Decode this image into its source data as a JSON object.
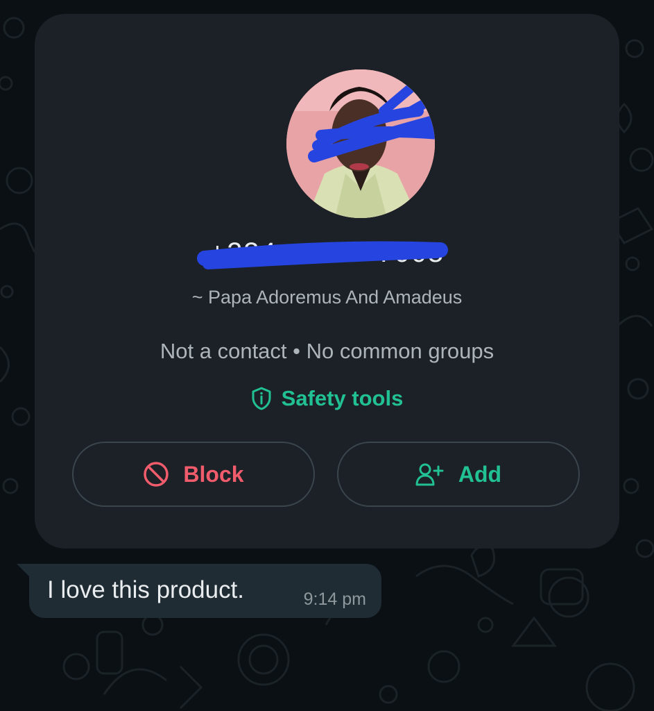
{
  "colors": {
    "background": "#0b1014",
    "card": "#1b2126",
    "accent_green": "#21c194",
    "danger_red": "#f15c6d",
    "text_primary": "#e9edef",
    "text_secondary": "#aeb5b9",
    "bubble": "#1f2c34"
  },
  "profile_card": {
    "avatar_icon": "profile-photo",
    "phone_number": "+234 ·· ·· ·· 7005",
    "push_name": "~ Papa Adoremus And Amadeus",
    "contact_status": "Not a contact • No common groups",
    "safety_tools": {
      "icon": "shield-info-icon",
      "label": "Safety tools"
    },
    "buttons": {
      "block": {
        "icon": "block-icon",
        "label": "Block"
      },
      "add": {
        "icon": "add-contact-icon",
        "label": "Add"
      }
    }
  },
  "message": {
    "text": "I love this product.",
    "time": "9:14 pm"
  }
}
